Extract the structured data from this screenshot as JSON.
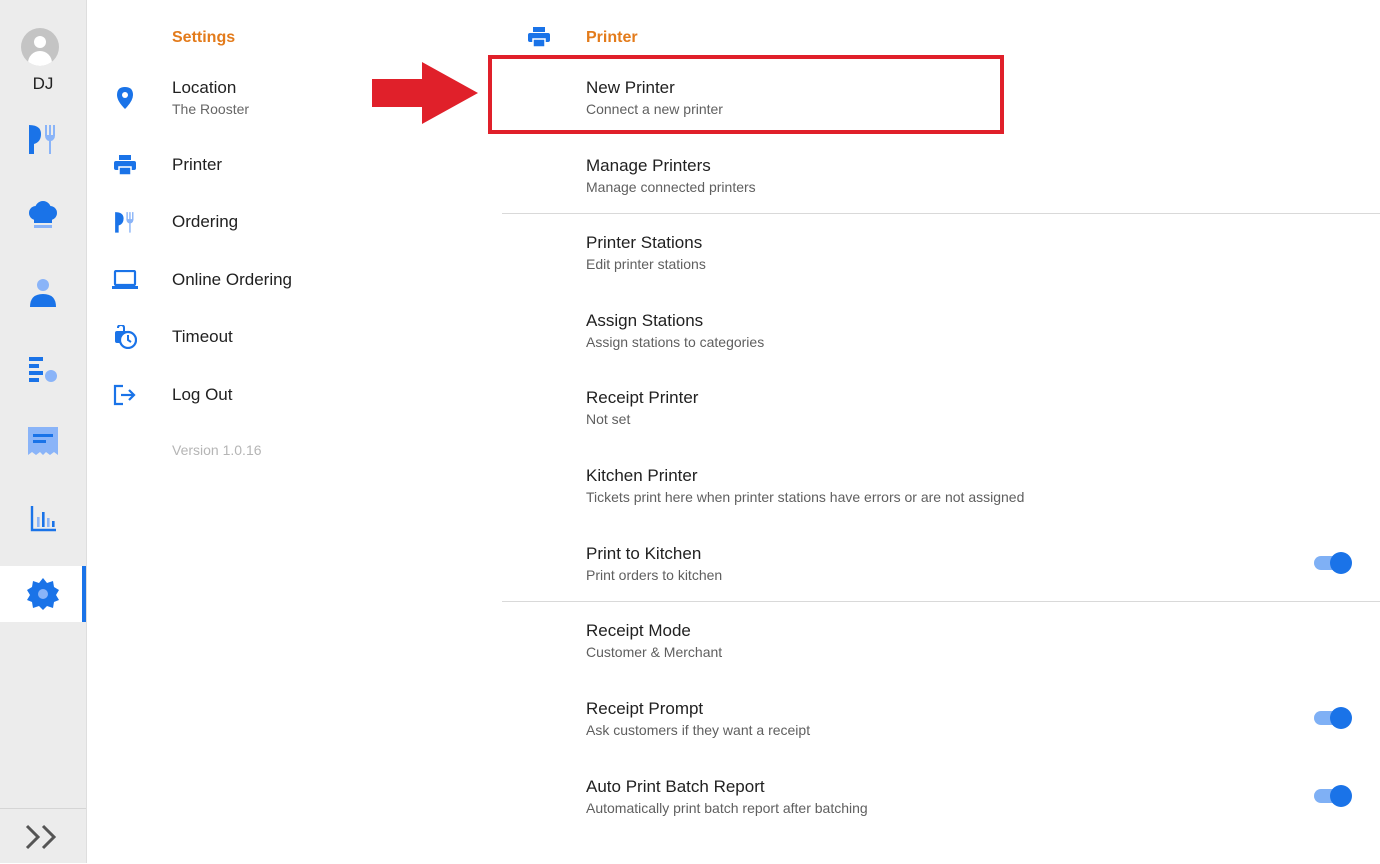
{
  "user": {
    "initials": "DJ"
  },
  "rail": {
    "items": [
      {
        "icon": "knife-fork-icon"
      },
      {
        "icon": "chef-hat-icon"
      },
      {
        "icon": "person-icon"
      },
      {
        "icon": "list-settings-icon"
      },
      {
        "icon": "receipt-icon"
      },
      {
        "icon": "bar-chart-icon"
      },
      {
        "icon": "gear-icon",
        "active": true
      }
    ],
    "expand_icon": "double-chevron-right-icon"
  },
  "menu": {
    "title": "Settings",
    "items": [
      {
        "label": "Location",
        "sub": "The Rooster",
        "icon": "location-pin-icon"
      },
      {
        "label": "Printer",
        "icon": "printer-icon"
      },
      {
        "label": "Ordering",
        "icon": "knife-fork-icon"
      },
      {
        "label": "Online Ordering",
        "icon": "laptop-icon"
      },
      {
        "label": "Timeout",
        "icon": "timer-lock-icon"
      },
      {
        "label": "Log Out",
        "icon": "logout-icon"
      }
    ],
    "version": "Version 1.0.16"
  },
  "panel": {
    "title": "Printer",
    "icon": "printer-icon",
    "rows": [
      {
        "title": "New Printer",
        "sub": "Connect a new printer"
      },
      {
        "title": "Manage Printers",
        "sub": "Manage connected printers"
      },
      {
        "title": "Printer Stations",
        "sub": "Edit printer stations"
      },
      {
        "title": "Assign Stations",
        "sub": "Assign stations to categories"
      },
      {
        "title": "Receipt Printer",
        "sub": "Not set"
      },
      {
        "title": "Kitchen Printer",
        "sub": "Tickets print here when printer stations have errors or are not assigned"
      },
      {
        "title": "Print to Kitchen",
        "sub": "Print orders to kitchen",
        "toggle": true
      },
      {
        "title": "Receipt Mode",
        "sub": "Customer & Merchant"
      },
      {
        "title": "Receipt Prompt",
        "sub": "Ask customers if they want a receipt",
        "toggle": true
      },
      {
        "title": "Auto Print Batch Report",
        "sub": "Automatically print batch report after batching",
        "toggle": true
      }
    ]
  },
  "colors": {
    "accent": "#1a73e8",
    "section_title": "#e37b1b",
    "annotation": "#e0202a"
  }
}
